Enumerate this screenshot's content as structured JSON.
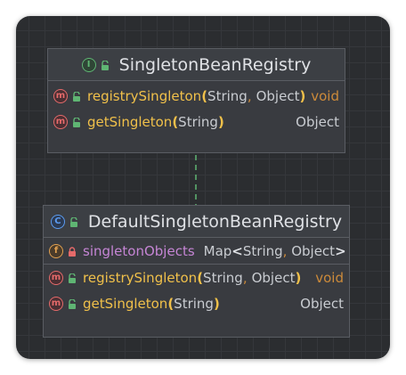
{
  "interface_node": {
    "title": "SingletonBeanRegistry",
    "type_badge": "I",
    "methods": [
      {
        "badge": "m",
        "name": "registrySingleton",
        "params": [
          "String",
          "Object"
        ],
        "returns": "void"
      },
      {
        "badge": "m",
        "name": "getSingleton",
        "params": [
          "String"
        ],
        "returns": "Object"
      }
    ]
  },
  "class_node": {
    "title": "DefaultSingletonBeanRegistry",
    "type_badge": "C",
    "fields": [
      {
        "badge": "f",
        "name": "singletonObjects",
        "type_prefix": "Map",
        "type_args": [
          "String",
          "Object"
        ]
      }
    ],
    "methods": [
      {
        "badge": "m",
        "name": "registrySingleton",
        "params": [
          "String",
          "Object"
        ],
        "returns": "void"
      },
      {
        "badge": "m",
        "name": "getSingleton",
        "params": [
          "String"
        ],
        "returns": "Object"
      }
    ]
  },
  "relation": {
    "type": "implements",
    "from": "DefaultSingletonBeanRegistry",
    "to": "SingletonBeanRegistry"
  },
  "punct": {
    "open": "(",
    "close": ")",
    "comma": ",",
    "lt": "<",
    "gt": ">"
  },
  "colors": {
    "background": "#2b2d30",
    "node_fill": "#393b40",
    "method_name": "#f0c04a",
    "field_name": "#c585d4",
    "keyword": "#cc8a3a",
    "interface_badge": "#5fb573",
    "class_badge": "#5b9bf0",
    "method_badge": "#e56a6a",
    "field_badge": "#e0a050",
    "arrow": "#5fb573"
  },
  "icons": {
    "interface": "interface-badge-icon",
    "class": "class-badge-icon",
    "method": "method-badge-icon",
    "field": "field-badge-icon",
    "public": "unlocked-icon",
    "private": "locked-icon"
  }
}
